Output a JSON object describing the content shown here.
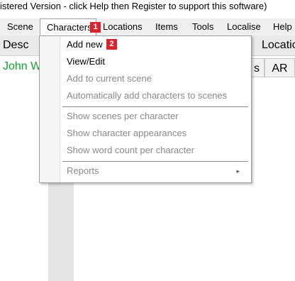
{
  "titlebar": {
    "text": "istered Version - click Help then Register to support this software)"
  },
  "menubar": {
    "items": [
      {
        "label": "Scene"
      },
      {
        "label": "Characters"
      },
      {
        "label": "Locations"
      },
      {
        "label": "Items"
      },
      {
        "label": "Tools"
      },
      {
        "label": "Localise"
      },
      {
        "label": "Help"
      }
    ]
  },
  "callouts": {
    "one": "1",
    "two": "2"
  },
  "row2": {
    "desc": "Desc",
    "location_partial": "Locatio"
  },
  "row3": {
    "name": "John W",
    "tab_s": "s",
    "tab_ar": "AR"
  },
  "characters_menu": {
    "items": [
      {
        "label": "Add new",
        "enabled": true
      },
      {
        "label": "View/Edit",
        "enabled": true
      },
      {
        "label": "Add to current scene",
        "enabled": false
      },
      {
        "label": "Automatically add characters to scenes",
        "enabled": false
      },
      {
        "label": "Show scenes per character",
        "enabled": false
      },
      {
        "label": "Show character appearances",
        "enabled": false
      },
      {
        "label": "Show word count per character",
        "enabled": false
      },
      {
        "label": "Reports",
        "enabled": false,
        "submenu_arrow": "▸"
      }
    ]
  },
  "colors": {
    "callout_bg": "#d9232e",
    "name_green": "#12a12a",
    "menubar_bg": "#f0f0f0",
    "disabled_text": "#8a8a8a"
  }
}
